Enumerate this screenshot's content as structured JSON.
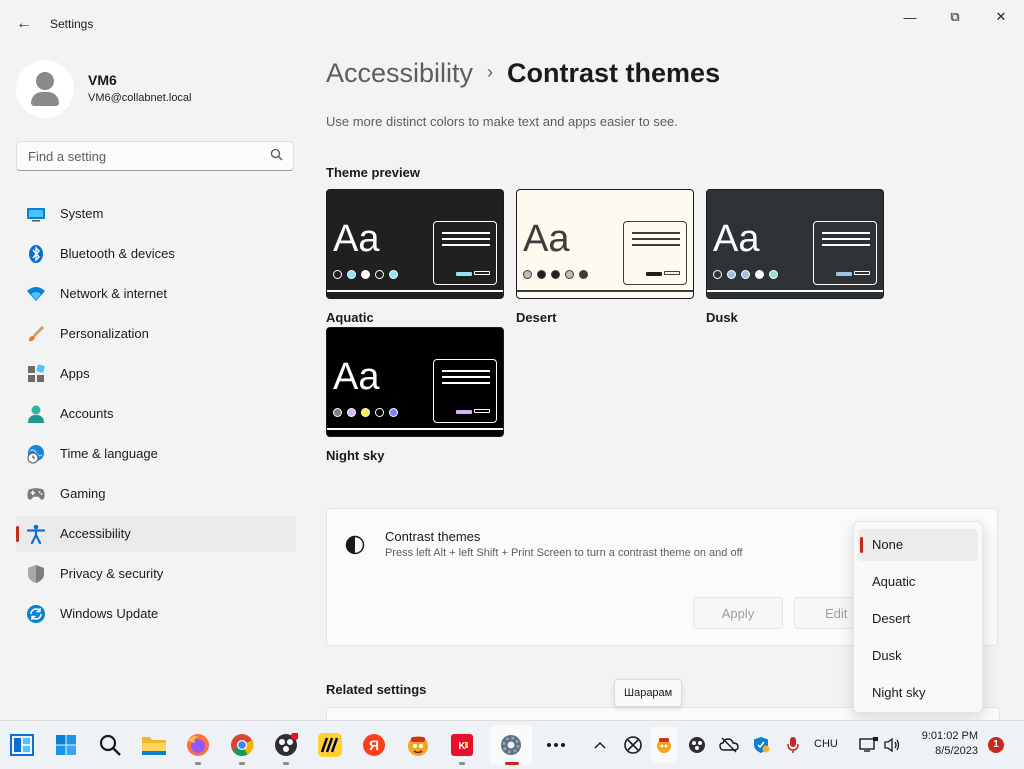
{
  "app": {
    "title": "Settings",
    "back_icon": "←",
    "minimize_icon": "—",
    "maximize_icon": "⧉",
    "close_icon": "✕"
  },
  "user": {
    "name": "VM6",
    "email": "VM6@collabnet.local"
  },
  "search": {
    "placeholder": "Find a setting",
    "icon": "⌕"
  },
  "sidebar": {
    "items": [
      {
        "label": "System",
        "icon": "monitor-icon"
      },
      {
        "label": "Bluetooth & devices",
        "icon": "bluetooth-icon"
      },
      {
        "label": "Network & internet",
        "icon": "wifi-icon"
      },
      {
        "label": "Personalization",
        "icon": "brush-icon"
      },
      {
        "label": "Apps",
        "icon": "apps-icon"
      },
      {
        "label": "Accounts",
        "icon": "person-icon"
      },
      {
        "label": "Time & language",
        "icon": "globe-clock-icon"
      },
      {
        "label": "Gaming",
        "icon": "gamepad-icon"
      },
      {
        "label": "Accessibility",
        "icon": "accessibility-icon",
        "selected": true
      },
      {
        "label": "Privacy & security",
        "icon": "shield-icon"
      },
      {
        "label": "Windows Update",
        "icon": "update-icon"
      }
    ]
  },
  "page": {
    "breadcrumb_parent": "Accessibility",
    "breadcrumb_separator": "›",
    "title": "Contrast themes",
    "subtitle": "Use more distinct colors to make text and apps easier to see."
  },
  "preview": {
    "title": "Theme preview",
    "sample_text": "Aa",
    "themes": [
      {
        "name": "Aquatic",
        "bg": "#202020",
        "fg": "#ffffff",
        "accent": "#8ee3f0",
        "border": "#ffffff",
        "dots": [
          "#202020",
          "#8ee3f0",
          "#ffffff",
          "#202020",
          "#8ee3f0"
        ]
      },
      {
        "name": "Desert",
        "bg": "#fffaef",
        "fg": "#3d3d3d",
        "accent": "#202020",
        "border": "#3d3d3d",
        "dots": [
          "#bdbdbd",
          "#202020",
          "#202020",
          "#bdbdbd",
          "#3d3d3d"
        ]
      },
      {
        "name": "Dusk",
        "bg": "#2d3236",
        "fg": "#ffffff",
        "accent": "#a1bfde",
        "border": "#ffffff",
        "dots": [
          "#2d3236",
          "#a1bfde",
          "#a1bfde",
          "#ffffff",
          "#8ee3d0"
        ]
      },
      {
        "name": "Night sky",
        "bg": "#000000",
        "fg": "#ffffff",
        "accent": "#d6b4fd",
        "border": "#ffffff",
        "dots": [
          "#7e7e7e",
          "#d6b4fd",
          "#ffee32",
          "#000000",
          "#8080ff"
        ]
      }
    ]
  },
  "contrast": {
    "title": "Contrast themes",
    "description": "Press left Alt + left Shift + Print Screen to turn a contrast theme on and off",
    "apply_label": "Apply",
    "edit_label": "Edit",
    "options": [
      "None",
      "Aquatic",
      "Desert",
      "Dusk",
      "Night sky"
    ],
    "selected": "None"
  },
  "related": {
    "title": "Related settings"
  },
  "tooltip": {
    "text": "Шарарам"
  },
  "taskbar": {
    "language": "CHU",
    "time": "9:01:02 PM",
    "date": "8/5/2023",
    "notifications": "1",
    "colors": {
      "accent": "#c42b1c"
    }
  }
}
